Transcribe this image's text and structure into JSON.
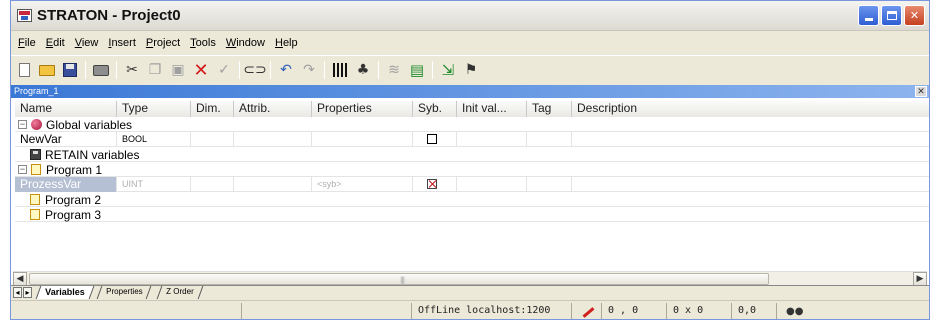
{
  "window": {
    "title": "STRATON - Project0"
  },
  "menu": [
    {
      "label": "File",
      "ul": "F",
      "rest": "ile"
    },
    {
      "label": "Edit",
      "ul": "E",
      "rest": "dit"
    },
    {
      "label": "View",
      "ul": "V",
      "rest": "iew"
    },
    {
      "label": "Insert",
      "ul": "I",
      "rest": "nsert"
    },
    {
      "label": "Project",
      "ul": "P",
      "rest": "roject"
    },
    {
      "label": "Tools",
      "ul": "T",
      "rest": "ools"
    },
    {
      "label": "Window",
      "ul": "W",
      "rest": "indow"
    },
    {
      "label": "Help",
      "ul": "H",
      "rest": "elp"
    }
  ],
  "mdi": {
    "title": "Program_1"
  },
  "columns": [
    "Name",
    "Type",
    "Dim.",
    "Attrib.",
    "Properties",
    "Syb.",
    "Init val...",
    "Tag",
    "Description"
  ],
  "rows": {
    "global": "Global variables",
    "newvar": {
      "name": "NewVar",
      "type": "BOOL"
    },
    "retain": "RETAIN variables",
    "program1": "Program 1",
    "prozessvar": {
      "name": "ProzessVar",
      "type": "UINT",
      "properties": "<syb>"
    },
    "program2": "Program 2",
    "program3": "Program 3"
  },
  "tabs": {
    "variables": "Variables",
    "properties": "Properties",
    "zorder": "Z Order"
  },
  "status": {
    "connection": "OffLine localhost:1200",
    "coords": "0 , 0",
    "size": "0 x 0",
    "zoom": "0,0"
  }
}
